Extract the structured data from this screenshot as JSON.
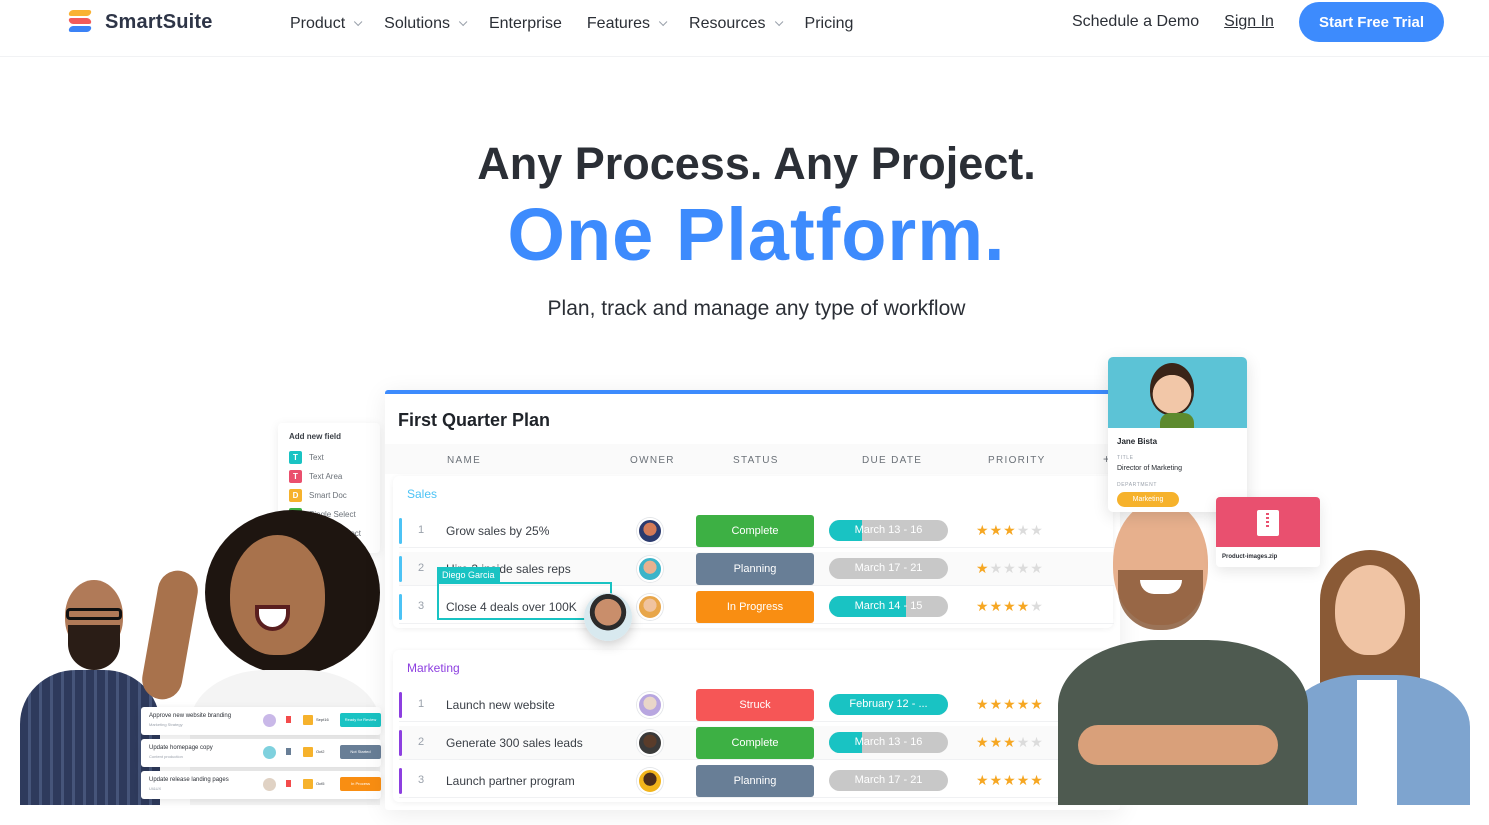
{
  "brand": {
    "name": "SmartSuite",
    "accent": "#3d8bfd"
  },
  "nav": {
    "items": [
      {
        "label": "Product",
        "has_dropdown": true
      },
      {
        "label": "Solutions",
        "has_dropdown": true
      },
      {
        "label": "Enterprise",
        "has_dropdown": false
      },
      {
        "label": "Features",
        "has_dropdown": true
      },
      {
        "label": "Resources",
        "has_dropdown": true
      },
      {
        "label": "Pricing",
        "has_dropdown": false
      }
    ],
    "schedule_demo": "Schedule a Demo",
    "sign_in": "Sign In",
    "start_trial": "Start Free Trial"
  },
  "hero": {
    "line1": "Any Process. Any Project.",
    "line2": "One Platform.",
    "subtitle": "Plan, track and manage any type of workflow"
  },
  "board": {
    "title": "First Quarter Plan",
    "columns": [
      "NAME",
      "OWNER",
      "STATUS",
      "DUE DATE",
      "PRIORITY"
    ],
    "add_column": "+",
    "groups": [
      {
        "name": "Sales",
        "color": "#4cc3f5",
        "rows": [
          {
            "num": "1",
            "name": "Grow sales by 25%",
            "status": "Complete",
            "status_color": "#3db044",
            "due": "March 13 - 16",
            "due_progress": 0.28,
            "priority": 3
          },
          {
            "num": "2",
            "name": "Hire 3 inside sales reps",
            "status": "Planning",
            "status_color": "#687e96",
            "due": "March 17 - 21",
            "due_progress": 0,
            "priority": 1
          },
          {
            "num": "3",
            "name": "Close 4 deals over 100K",
            "status": "In Progress",
            "status_color": "#f98e12",
            "due": "March 14 - 15",
            "due_progress": 0.65,
            "priority": 4
          }
        ]
      },
      {
        "name": "Marketing",
        "color": "#8d3fe0",
        "rows": [
          {
            "num": "1",
            "name": "Launch new website",
            "status": "Struck",
            "status_color": "#f65656",
            "due": "February 12 - ...",
            "due_progress": 1,
            "priority": 5
          },
          {
            "num": "2",
            "name": "Generate 300 sales leads",
            "status": "Complete",
            "status_color": "#3db044",
            "due": "March 13 - 16",
            "due_progress": 0.28,
            "priority": 3
          },
          {
            "num": "3",
            "name": "Launch partner program",
            "status": "Planning",
            "status_color": "#687e96",
            "due": "March 17 - 21",
            "due_progress": 0,
            "priority": 5
          }
        ]
      }
    ],
    "editing_user": "Diego Garcia"
  },
  "add_field_panel": {
    "title": "Add new field",
    "items": [
      {
        "label": "Text",
        "icon": "T",
        "color": "#19c3c3"
      },
      {
        "label": "Text Area",
        "icon": "T",
        "color": "#ea4f6d"
      },
      {
        "label": "Smart Doc",
        "icon": "D",
        "color": "#f6b22c"
      },
      {
        "label": "Single Select",
        "icon": "◉",
        "color": "#3db044"
      },
      {
        "label": "Multiple Select",
        "icon": "◉",
        "color": "#3db044"
      }
    ]
  },
  "profile_card": {
    "name": "Jane Bista",
    "title_label": "TITLE",
    "title": "Director of Marketing",
    "department_label": "DEPARTMENT",
    "department": "Marketing"
  },
  "file_card": {
    "name": "Product-images.zip"
  },
  "mini_tasks": [
    {
      "title": "Approve new website branding",
      "subtitle": "Marketing Strategy",
      "flag_color": "#f34b4b",
      "date": "Sept16",
      "status": "Ready for Review",
      "status_color": "#19c3c3"
    },
    {
      "title": "Update homepage copy",
      "subtitle": "Content production",
      "flag_color": "#687e96",
      "date": "Oct2",
      "status": "Not Started",
      "status_color": "#687e96"
    },
    {
      "title": "Update release landing pages",
      "subtitle": "UI&UX",
      "flag_color": "#f34b4b",
      "date": "Oct5",
      "status": "In Process",
      "status_color": "#f98e12"
    }
  ]
}
